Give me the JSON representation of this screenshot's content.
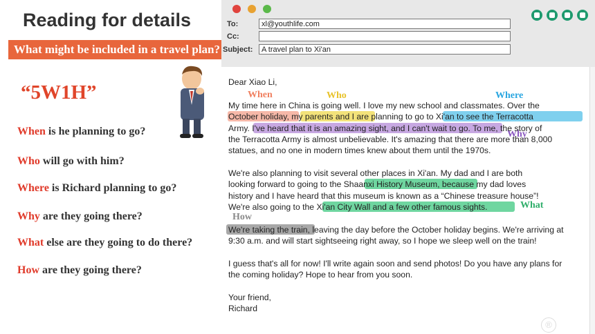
{
  "slide": {
    "title": "Reading for details",
    "question_banner": "What might be included in a travel plan?",
    "five_w": "“5W1H”",
    "questions": [
      {
        "keyword": "When",
        "rest": " is he planning to go?"
      },
      {
        "keyword": "Who",
        "rest": " will go with him?"
      },
      {
        "keyword": "Where",
        "rest": " is Richard planning to go?"
      },
      {
        "keyword": "Why",
        "rest": " are they going there?"
      },
      {
        "keyword": "What",
        "rest": " else are they going to do there?"
      },
      {
        "keyword": "How",
        "rest": " are they going there?"
      }
    ]
  },
  "email": {
    "to_label": "To:",
    "to_value": "xl@youthlife.com",
    "cc_label": "Cc:",
    "cc_value": "",
    "subject_label": "Subject:",
    "subject_value": "A travel plan to Xi'an",
    "lines": [
      "Dear Xiao Li,",
      "My time here in China is going well. I love my new school and classmates. Over the",
      "October holiday, my parents and I are planning to go to Xi'an to see the Terracotta",
      "Army. I've heard that it is an amazing sight, and I can't wait to go. To me, the story of",
      "the Terracotta Army is almost unbelievable. It's amazing that there are more than 8,000",
      "statues, and no one in modern times knew about them until the 1970s.",
      "We're also planning to visit several other places in Xi'an. My dad and I are both",
      "looking forward to going to the Shaanxi History Museum, because my dad loves",
      "history and I have heard that this museum is known as a “Chinese treasure house”!",
      "We're also going to the Xi'an City Wall and a few other famous sights.",
      "We're taking the train, leaving the day before the October holiday begins. We're arriving at",
      "9:30 a.m. and will start sightseeing right away, so I hope we sleep well on the train!",
      "I guess that's all for now! I'll write again soon and send photos! Do you have any plans for",
      "the coming holiday? Hope to hear from you soon.",
      "Your friend,",
      "Richard"
    ],
    "annotations": {
      "when": "When",
      "who": "Who",
      "where": "Where",
      "why": "Why",
      "what": "What",
      "how": "How"
    }
  },
  "colors": {
    "banner": "#e8663c",
    "keyword": "#e03a2a",
    "when_hl": "#f6b8a8",
    "who_hl": "#f3e27a",
    "where_hl": "#7fd0ee",
    "why_hl": "#c7a8e2",
    "what_hl": "#6fd6a0",
    "how_hl": "#a8a8a8"
  },
  "icons": [
    "close-dot",
    "minimize-dot",
    "zoom-dot",
    "save-icon",
    "folder-icon",
    "print-icon",
    "settings-icon",
    "teacher-figure"
  ]
}
